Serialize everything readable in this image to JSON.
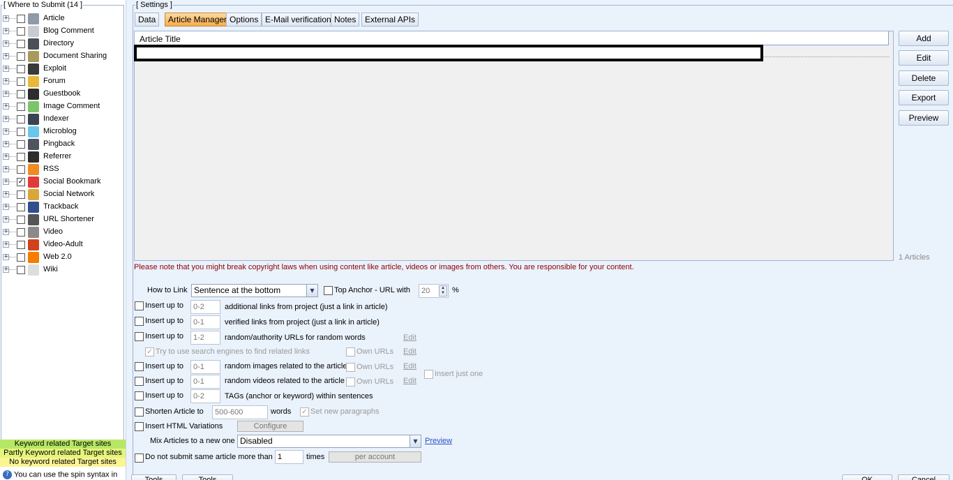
{
  "left_panel": {
    "title": "[ Where to Submit  (14 ]",
    "items": [
      {
        "label": "Article",
        "checked": false,
        "icon": "article-icon",
        "color": "#8e9aa6"
      },
      {
        "label": "Blog Comment",
        "checked": false,
        "icon": "speech-bubble-icon",
        "color": "#c8ccd2"
      },
      {
        "label": "Directory",
        "checked": false,
        "icon": "directory-icon",
        "color": "#4a5058"
      },
      {
        "label": "Document Sharing",
        "checked": false,
        "icon": "folder-icon",
        "color": "#a89a5c"
      },
      {
        "label": "Exploit",
        "checked": false,
        "icon": "bug-icon",
        "color": "#3a3a3a"
      },
      {
        "label": "Forum",
        "checked": false,
        "icon": "users-icon",
        "color": "#e7b83a"
      },
      {
        "label": "Guestbook",
        "checked": false,
        "icon": "book-icon",
        "color": "#2d2d2d"
      },
      {
        "label": "Image Comment",
        "checked": false,
        "icon": "image-icon",
        "color": "#7bc46b"
      },
      {
        "label": "Indexer",
        "checked": false,
        "icon": "list-icon",
        "color": "#3b4250"
      },
      {
        "label": "Microblog",
        "checked": false,
        "icon": "bird-icon",
        "color": "#6cc6ec"
      },
      {
        "label": "Pingback",
        "checked": false,
        "icon": "pingback-icon",
        "color": "#4f5560"
      },
      {
        "label": "Referrer",
        "checked": false,
        "icon": "referrer-icon",
        "color": "#2d2d2d"
      },
      {
        "label": "RSS",
        "checked": false,
        "icon": "rss-icon",
        "color": "#f08a24"
      },
      {
        "label": "Social Bookmark",
        "checked": true,
        "icon": "heart-icon",
        "color": "#e03a3a"
      },
      {
        "label": "Social Network",
        "checked": false,
        "icon": "people-icon",
        "color": "#d9a63a"
      },
      {
        "label": "Trackback",
        "checked": false,
        "icon": "trackback-icon",
        "color": "#2f4f8f"
      },
      {
        "label": "URL Shortener",
        "checked": false,
        "icon": "double-chevron-icon",
        "color": "#555555"
      },
      {
        "label": "Video",
        "checked": false,
        "icon": "film-icon",
        "color": "#8a8a8a"
      },
      {
        "label": "Video-Adult",
        "checked": false,
        "icon": "adult-video-icon",
        "color": "#d0421b"
      },
      {
        "label": "Web 2.0",
        "checked": false,
        "icon": "blogger-icon",
        "color": "#f57d00"
      },
      {
        "label": "Wiki",
        "checked": false,
        "icon": "wiki-icon",
        "color": "#dddddd"
      }
    ],
    "legend": {
      "keyword": "Keyword related Target sites",
      "partly": "Partly Keyword related Target sites",
      "none": "No keyword related Target sites"
    },
    "spin_note": "You can use the spin syntax in"
  },
  "settings": {
    "title": "[ Settings ]",
    "tabs": [
      "Data",
      "Article Manager",
      "Options",
      "E-Mail verification",
      "Notes",
      "External APIs"
    ],
    "active_tab": "Article Manager",
    "list_header": "Article Title",
    "buttons": {
      "add": "Add",
      "edit": "Edit",
      "delete": "Delete",
      "export": "Export",
      "preview": "Preview"
    },
    "articles_count": "1 Articles",
    "copyright_note": "Please note that you might break copyright laws when using content like article, videos or images from others. You are responsible for your content.",
    "how_to_link": {
      "label": "How to Link",
      "value": "Sentence at the bottom",
      "top_anchor_label": "Top Anchor - URL with",
      "top_anchor_value": "20",
      "percent": "%"
    },
    "insert_label": "Insert up to",
    "rows": {
      "additional": {
        "value": "0-2",
        "text": "additional links from project (just a link in article)"
      },
      "verified": {
        "value": "0-1",
        "text": "verified links from project (just a link in article)"
      },
      "random_authority": {
        "value": "1-2",
        "text": "random/authority URLs for random words",
        "edit": "Edit"
      },
      "search_engines": {
        "text": "Try to use search engines to find related links",
        "own_urls": "Own URLs",
        "edit": "Edit"
      },
      "images": {
        "value": "0-1",
        "text": "random images related to the article",
        "own_urls": "Own URLs",
        "edit": "Edit"
      },
      "videos": {
        "value": "0-1",
        "text": "random videos related to the article",
        "own_urls": "Own URLs",
        "edit": "Edit"
      },
      "insert_just_one": "Insert just one",
      "tags": {
        "value": "0-2",
        "text": "TAGs (anchor or keyword) within sentences"
      }
    },
    "shorten": {
      "label": "Shorten Article to",
      "value": "500-600",
      "words": "words",
      "new_paragraphs": "Set new paragraphs"
    },
    "html_variations": {
      "label": "Insert HTML Variations",
      "configure": "Configure"
    },
    "mix": {
      "label": "Mix Articles to a new one",
      "value": "Disabled",
      "preview": "Preview"
    },
    "same_article": {
      "label": "Do not submit same article more than",
      "value": "1",
      "times": "times",
      "per_account": "per account"
    },
    "bottom_buttons": {
      "tools1": "Tools",
      "tools2": "Tools",
      "ok": "OK",
      "cancel": "Cancel"
    }
  }
}
